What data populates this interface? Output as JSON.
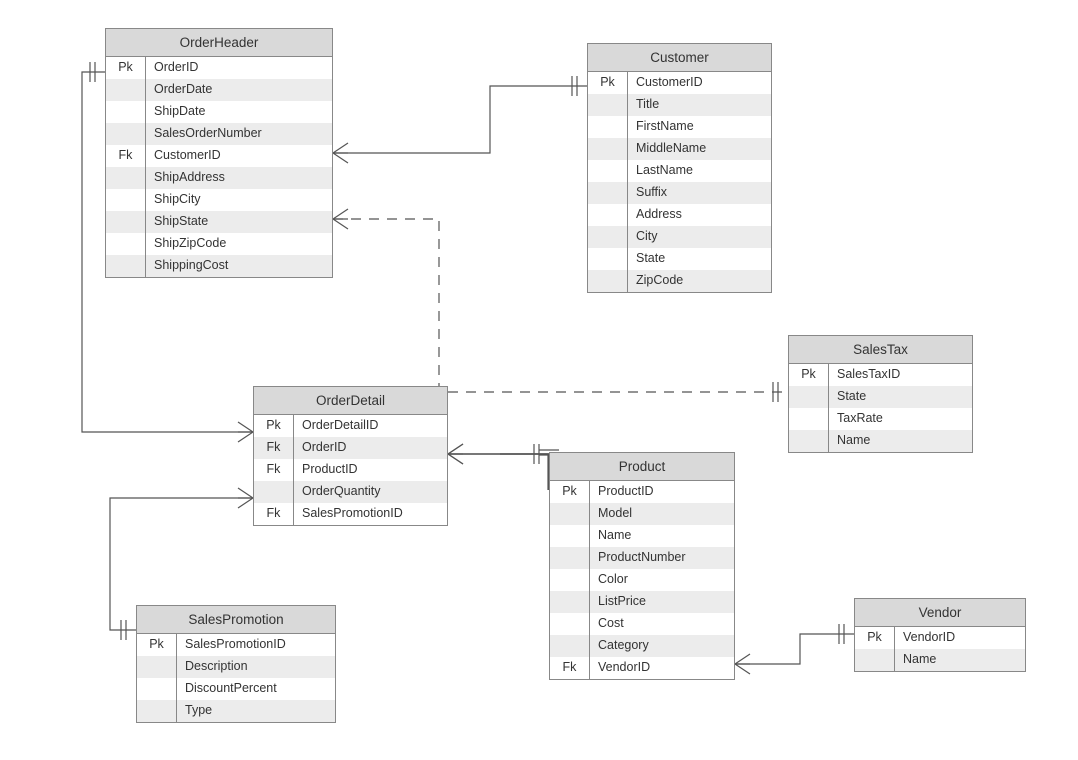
{
  "diagram_type": "ERD",
  "entities": {
    "orderHeader": {
      "title": "OrderHeader",
      "rows": [
        {
          "key": "Pk",
          "attr": "OrderID"
        },
        {
          "key": "",
          "attr": "OrderDate"
        },
        {
          "key": "",
          "attr": "ShipDate"
        },
        {
          "key": "",
          "attr": "SalesOrderNumber"
        },
        {
          "key": "Fk",
          "attr": "CustomerID"
        },
        {
          "key": "",
          "attr": "ShipAddress"
        },
        {
          "key": "",
          "attr": "ShipCity"
        },
        {
          "key": "",
          "attr": "ShipState"
        },
        {
          "key": "",
          "attr": "ShipZipCode"
        },
        {
          "key": "",
          "attr": "ShippingCost"
        }
      ]
    },
    "customer": {
      "title": "Customer",
      "rows": [
        {
          "key": "Pk",
          "attr": "CustomerID"
        },
        {
          "key": "",
          "attr": "Title"
        },
        {
          "key": "",
          "attr": "FirstName"
        },
        {
          "key": "",
          "attr": "MiddleName"
        },
        {
          "key": "",
          "attr": "LastName"
        },
        {
          "key": "",
          "attr": "Suffix"
        },
        {
          "key": "",
          "attr": "Address"
        },
        {
          "key": "",
          "attr": "City"
        },
        {
          "key": "",
          "attr": "State"
        },
        {
          "key": "",
          "attr": "ZipCode"
        }
      ]
    },
    "salesTax": {
      "title": "SalesTax",
      "rows": [
        {
          "key": "Pk",
          "attr": "SalesTaxID"
        },
        {
          "key": "",
          "attr": "State"
        },
        {
          "key": "",
          "attr": "TaxRate"
        },
        {
          "key": "",
          "attr": "Name"
        }
      ]
    },
    "orderDetail": {
      "title": "OrderDetail",
      "rows": [
        {
          "key": "Pk",
          "attr": "OrderDetailID"
        },
        {
          "key": "Fk",
          "attr": "OrderID"
        },
        {
          "key": "Fk",
          "attr": "ProductID"
        },
        {
          "key": "",
          "attr": "OrderQuantity"
        },
        {
          "key": "Fk",
          "attr": "SalesPromotionID"
        }
      ]
    },
    "product": {
      "title": "Product",
      "rows": [
        {
          "key": "Pk",
          "attr": "ProductID"
        },
        {
          "key": "",
          "attr": "Model"
        },
        {
          "key": "",
          "attr": "Name"
        },
        {
          "key": "",
          "attr": "ProductNumber"
        },
        {
          "key": "",
          "attr": "Color"
        },
        {
          "key": "",
          "attr": "ListPrice"
        },
        {
          "key": "",
          "attr": "Cost"
        },
        {
          "key": "",
          "attr": "Category"
        },
        {
          "key": "Fk",
          "attr": "VendorID"
        }
      ]
    },
    "salesPromotion": {
      "title": "SalesPromotion",
      "rows": [
        {
          "key": "Pk",
          "attr": "SalesPromotionID"
        },
        {
          "key": "",
          "attr": "Description"
        },
        {
          "key": "",
          "attr": "DiscountPercent"
        },
        {
          "key": "",
          "attr": "Type"
        }
      ]
    },
    "vendor": {
      "title": "Vendor",
      "rows": [
        {
          "key": "Pk",
          "attr": "VendorID"
        },
        {
          "key": "",
          "attr": "Name"
        }
      ]
    }
  },
  "relationships": [
    {
      "from": "OrderHeader.CustomerID",
      "to": "Customer.CustomerID",
      "cardinality": "many-to-one",
      "style": "solid"
    },
    {
      "from": "OrderHeader.ShipState",
      "to": "SalesTax.State",
      "cardinality": "many-to-one",
      "style": "dashed"
    },
    {
      "from": "OrderDetail.OrderID",
      "to": "OrderHeader.OrderID",
      "cardinality": "many-to-one",
      "style": "solid"
    },
    {
      "from": "OrderDetail.ProductID",
      "to": "Product.ProductID",
      "cardinality": "many-to-one",
      "style": "solid"
    },
    {
      "from": "OrderDetail.SalesPromotionID",
      "to": "SalesPromotion.SalesPromotionID",
      "cardinality": "many-to-one",
      "style": "solid"
    },
    {
      "from": "Product.VendorID",
      "to": "Vendor.VendorID",
      "cardinality": "many-to-one",
      "style": "solid"
    }
  ]
}
